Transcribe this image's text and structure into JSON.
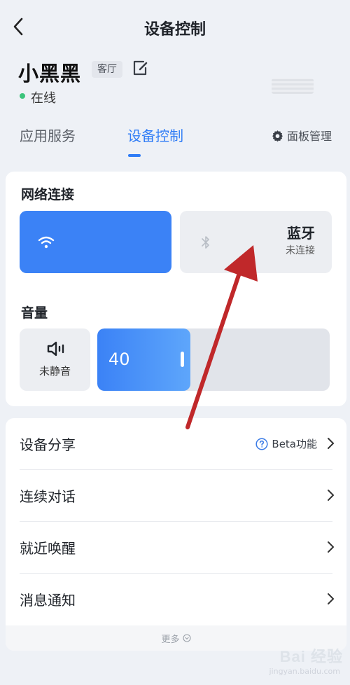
{
  "header": {
    "title": "设备控制",
    "back_icon": "chevron-left-icon"
  },
  "device": {
    "name": "小黑黑",
    "room": "客厅",
    "status": "在线",
    "status_color": "#3cc47c",
    "edit_icon": "edit-icon"
  },
  "tabs": [
    {
      "label": "应用服务",
      "active": false
    },
    {
      "label": "设备控制",
      "active": true
    }
  ],
  "panel_management": {
    "label": "面板管理",
    "icon": "gear-icon"
  },
  "network": {
    "section_title": "网络连接",
    "wifi": {
      "icon": "wifi-icon",
      "active": true
    },
    "bluetooth": {
      "title": "蓝牙",
      "status": "未连接",
      "icon": "bluetooth-icon"
    }
  },
  "volume": {
    "section_title": "音量",
    "mute_label": "未静音",
    "value": "40",
    "level_fraction": 0.4,
    "speaker_icon": "speaker-icon"
  },
  "list": [
    {
      "label": "设备分享",
      "extra": "Beta功能",
      "extra_icon": "help-circle-icon"
    },
    {
      "label": "连续对话"
    },
    {
      "label": "就近唤醒"
    },
    {
      "label": "消息通知"
    }
  ],
  "more": {
    "label": "更多",
    "icon": "chevron-down-circle-icon"
  },
  "accent_color": "#2f7cf6",
  "annotation_arrow_color": "#c0282a",
  "watermark": {
    "text": "Bai 经验",
    "sub": "jingyan.baidu.com"
  }
}
